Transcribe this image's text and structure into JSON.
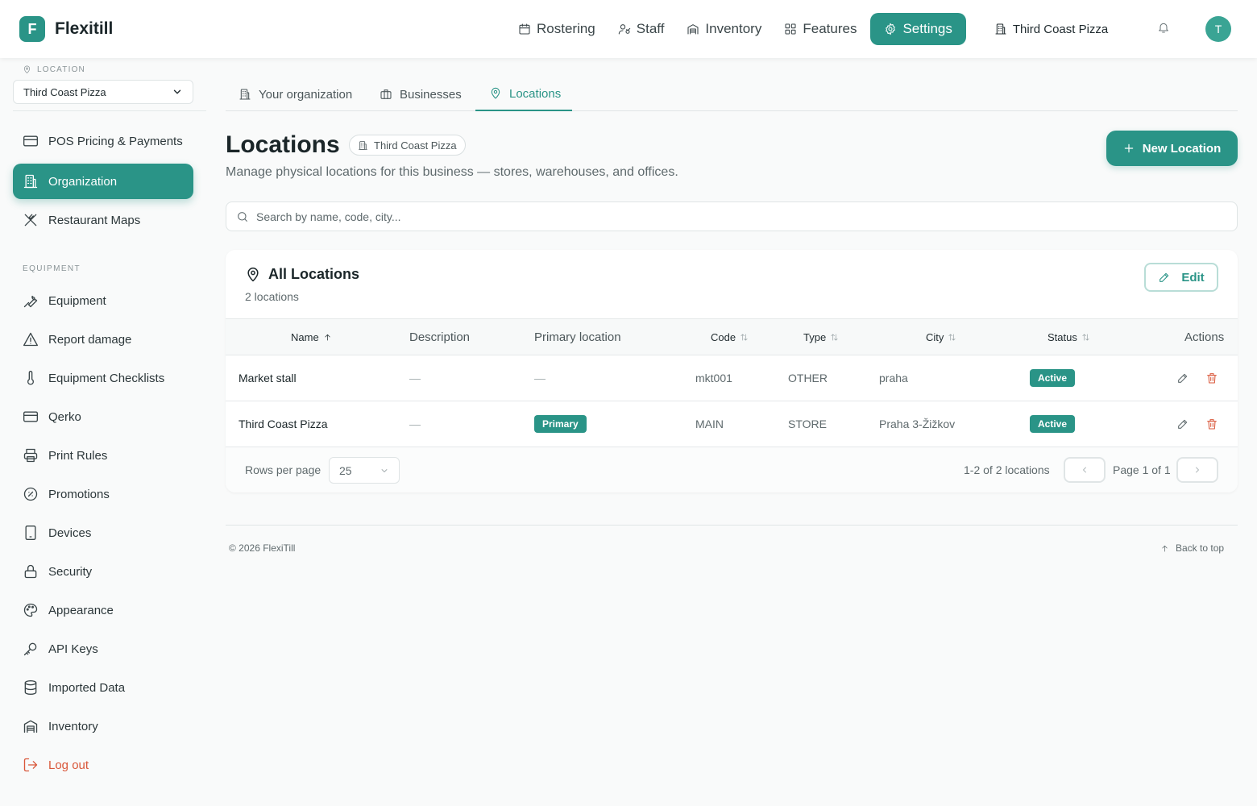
{
  "brand": {
    "mark": "F",
    "name": "Flexitill"
  },
  "colors": {
    "accent": "#2a9487",
    "danger": "#d9573a"
  },
  "topnav": {
    "items": [
      {
        "label": "Rostering",
        "icon": "calendar-icon"
      },
      {
        "label": "Staff",
        "icon": "users-icon"
      },
      {
        "label": "Inventory",
        "icon": "warehouse-icon"
      },
      {
        "label": "Features",
        "icon": "grid-icon"
      },
      {
        "label": "Settings",
        "icon": "gear-icon",
        "active": true
      }
    ],
    "org": "Third Coast Pizza",
    "avatar": "T"
  },
  "sidebar": {
    "location_label": "LOCATION",
    "location_value": "Third Coast Pizza",
    "top_items": [
      {
        "label": "POS Pricing & Payments",
        "icon": "credit-card-icon"
      },
      {
        "label": "Organization",
        "icon": "building-icon",
        "active": true
      },
      {
        "label": "Restaurant Maps",
        "icon": "utensils-icon"
      }
    ],
    "section_label": "EQUIPMENT",
    "items": [
      {
        "label": "Equipment",
        "icon": "wrench-icon"
      },
      {
        "label": "Report damage",
        "icon": "warning-icon"
      },
      {
        "label": "Equipment Checklists",
        "icon": "thermometer-icon"
      },
      {
        "label": "Qerko",
        "icon": "card-icon"
      },
      {
        "label": "Print Rules",
        "icon": "printer-icon"
      },
      {
        "label": "Promotions",
        "icon": "percent-badge-icon"
      },
      {
        "label": "Devices",
        "icon": "tablet-icon"
      },
      {
        "label": "Security",
        "icon": "lock-icon"
      },
      {
        "label": "Appearance",
        "icon": "palette-icon"
      },
      {
        "label": "API Keys",
        "icon": "key-icon"
      },
      {
        "label": "Imported Data",
        "icon": "database-icon"
      },
      {
        "label": "Inventory",
        "icon": "warehouse-icon"
      }
    ],
    "logout": "Log out"
  },
  "tabs": [
    {
      "label": "Your organization",
      "icon": "building-icon"
    },
    {
      "label": "Businesses",
      "icon": "briefcase-icon"
    },
    {
      "label": "Locations",
      "icon": "map-pin-icon",
      "active": true
    }
  ],
  "page": {
    "title": "Locations",
    "chip": "Third Coast Pizza",
    "subtitle": "Manage physical locations for this business — stores, warehouses, and offices.",
    "new_button": "New Location"
  },
  "search": {
    "placeholder": "Search by name, code, city..."
  },
  "card": {
    "title": "All Locations",
    "count": "2 locations",
    "edit_label": "Edit"
  },
  "table": {
    "columns": {
      "name": "Name",
      "description": "Description",
      "primary": "Primary location",
      "code": "Code",
      "type": "Type",
      "city": "City",
      "status": "Status",
      "actions": "Actions"
    },
    "rows": [
      {
        "name": "Market stall",
        "description": "—",
        "primary": "—",
        "code": "mkt001",
        "type": "OTHER",
        "city": "praha",
        "status": "Active"
      },
      {
        "name": "Third Coast Pizza",
        "description": "—",
        "primary": "Primary",
        "code": "MAIN",
        "type": "STORE",
        "city": "Praha 3-Žižkov",
        "status": "Active"
      }
    ]
  },
  "pagination": {
    "rows_label": "Rows per page",
    "rows_value": "25",
    "range": "1-2 of 2 locations",
    "page": "Page 1 of 1"
  },
  "footer": {
    "copyright": "© 2026 FlexiTill",
    "back_to_top": "Back to top"
  }
}
